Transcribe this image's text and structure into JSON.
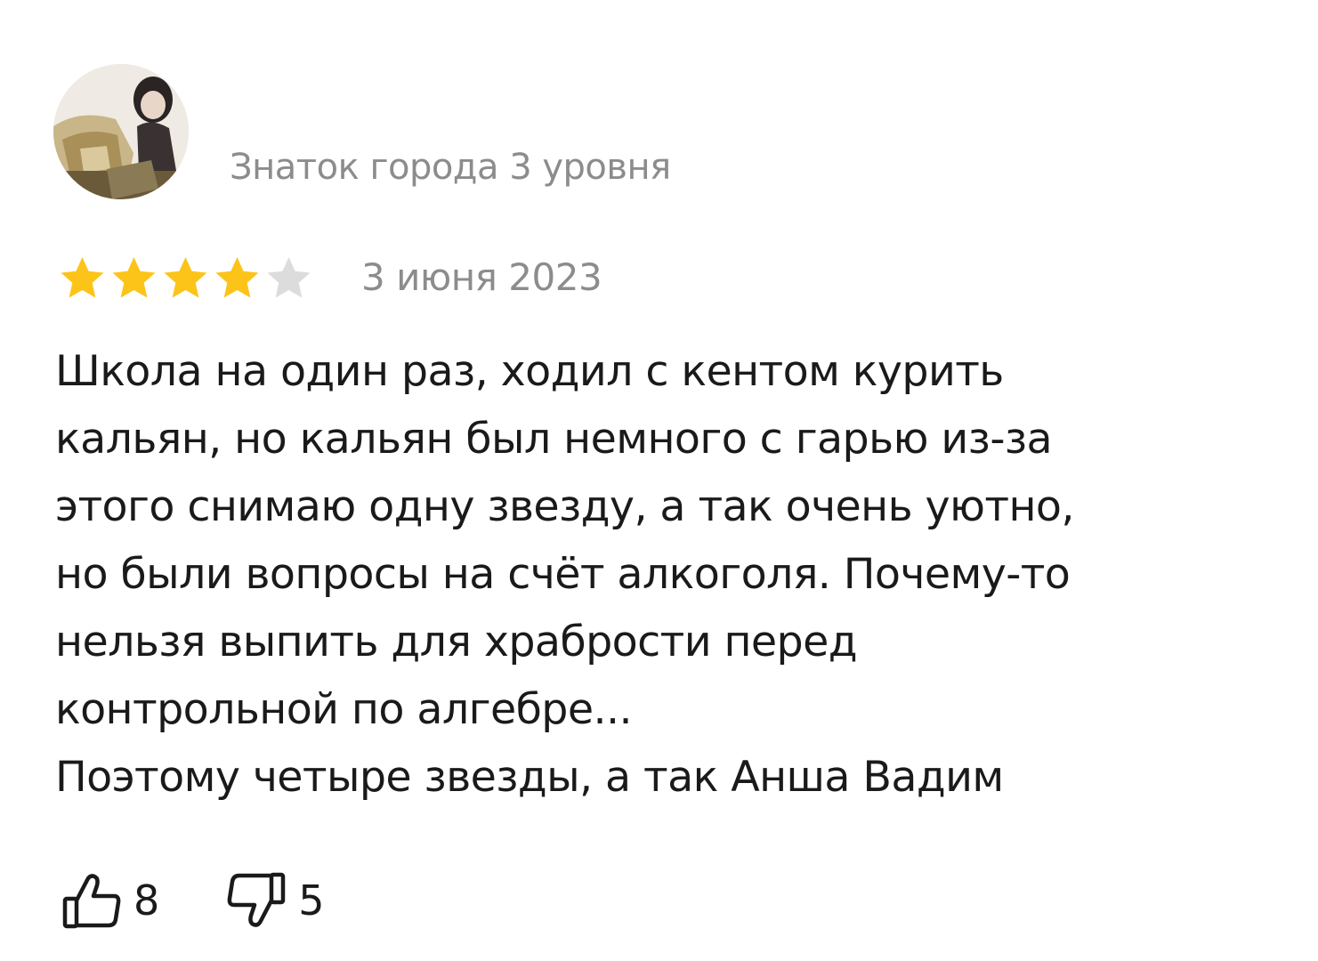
{
  "review": {
    "author_level": "Знаток города 3 уровня",
    "rating": 4,
    "rating_max": 5,
    "date": "3 июня 2023",
    "text_lines": [
      "Школа на один раз, ходил с кентом курить",
      "кальян, но кальян был немного с гарью из-за",
      "этого снимаю одну звезду, а так очень уютно,",
      "но были вопросы на счёт алкоголя. Почему-то",
      "нельзя выпить для храбрости перед",
      "контрольной по алгебре...",
      "Поэтому четыре звезды, а так Анша Вадим"
    ],
    "likes": "8",
    "dislikes": "5"
  },
  "icons": {
    "avatar": "avatar-photo",
    "star": "star-icon",
    "like": "thumbs-up-icon",
    "dislike": "thumbs-down-icon"
  },
  "colors": {
    "text": "#1a1a1a",
    "muted": "#8c8c8c",
    "star_filled": "#fcc419",
    "star_empty": "#dcdcdc",
    "icon": "#1a1a1a",
    "background": "#ffffff"
  }
}
